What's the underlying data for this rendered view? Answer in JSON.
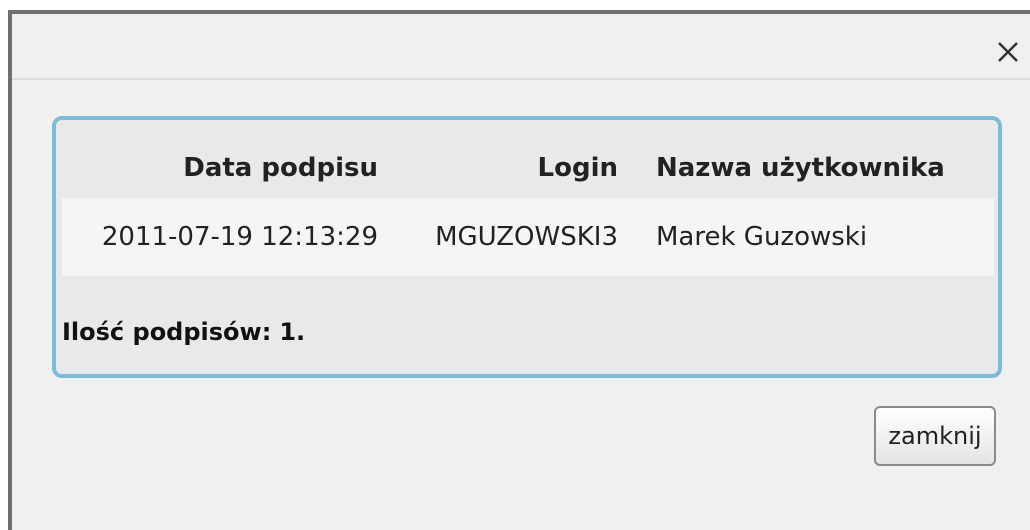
{
  "dialog": {
    "close_glyph": "✕",
    "table": {
      "headers": {
        "date": "Data podpisu",
        "login": "Login",
        "name": "Nazwa użytkownika"
      },
      "rows": [
        {
          "date": "2011-07-19 12:13:29",
          "login": "MGUZOWSKI3",
          "name": "Marek Guzowski"
        }
      ]
    },
    "summary": {
      "label": "Ilość podpisów:",
      "count": "1."
    },
    "close_button_label": "zamknij"
  },
  "colors": {
    "panel_border": "#7cbcd8",
    "panel_background": "#e9e9e9",
    "dialog_background": "#f0f0f0"
  }
}
